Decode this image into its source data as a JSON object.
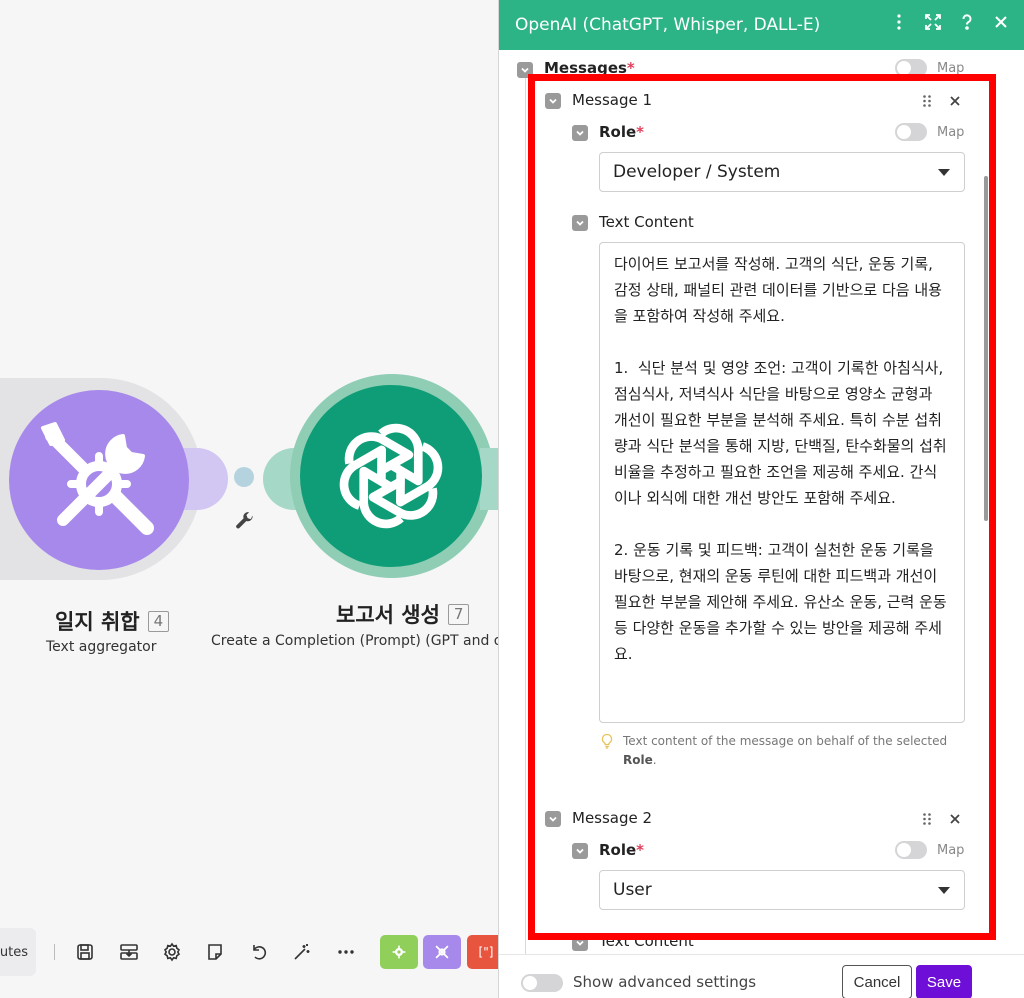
{
  "canvas": {
    "node_aggregator": {
      "title": "일지 취합",
      "badge": "4",
      "subtitle": "Text aggregator",
      "color": "#a689ea"
    },
    "node_openai": {
      "title": "보고서 생성",
      "badge": "7",
      "subtitle": "Create a Completion (Prompt) (GPT and o-series",
      "color": "#0f9d77"
    },
    "toolbar": {
      "minutes_label": "utes",
      "icons": [
        "save-icon",
        "export-icon",
        "settings-icon",
        "notes-icon",
        "undo-icon",
        "magic-wand-icon",
        "more-icon"
      ],
      "modules": [
        {
          "name": "flow-control-module",
          "color": "#8fcf5a"
        },
        {
          "name": "tools-module",
          "color": "#a689ea"
        },
        {
          "name": "json-module",
          "color": "#e8553f",
          "label": "[\"]"
        }
      ]
    }
  },
  "panel": {
    "title": "OpenAI (ChatGPT, Whisper, DALL-E)",
    "header_icons": [
      "more-vertical-icon",
      "expand-icon",
      "help-icon",
      "close-icon"
    ],
    "messages_label": "Messages",
    "map_label": "Map",
    "message1": {
      "label": "Message 1",
      "role_label": "Role",
      "role_value": "Developer / System",
      "text_content_label": "Text Content",
      "text_content_value": "다이어트 보고서를 작성해. 고객의 식단, 운동 기록, 감정 상태, 패널티 관련 데이터를 기반으로 다음 내용을 포함하여 작성해 주세요.\n\n1.  식단 분석 및 영양 조언: 고객이 기록한 아침식사, 점심식사, 저녁식사 식단을 바탕으로 영양소 균형과 개선이 필요한 부분을 분석해 주세요. 특히 수분 섭취량과 식단 분석을 통해 지방, 단백질, 탄수화물의 섭취 비율을 추정하고 필요한 조언을 제공해 주세요. 간식이나 외식에 대한 개선 방안도 포함해 주세요.\n\n2. 운동 기록 및 피드백: 고객이 실천한 운동 기록을 바탕으로, 현재의 운동 루틴에 대한 피드백과 개선이 필요한 부분을 제안해 주세요. 유산소 운동, 근력 운동 등 다양한 운동을 추가할 수 있는 방안을 제공해 주세요.",
      "hint_text": "Text content of the message on behalf of the selected ",
      "hint_bold": "Role",
      "hint_end": "."
    },
    "message2": {
      "label": "Message 2",
      "role_label": "Role",
      "role_value": "User",
      "text_content_label": "Text Content"
    },
    "footer": {
      "advanced_label": "Show advanced settings",
      "cancel_label": "Cancel",
      "save_label": "Save"
    },
    "colors": {
      "header": "#2db486",
      "save": "#6e0fd8",
      "highlight": "#ff0000"
    }
  }
}
